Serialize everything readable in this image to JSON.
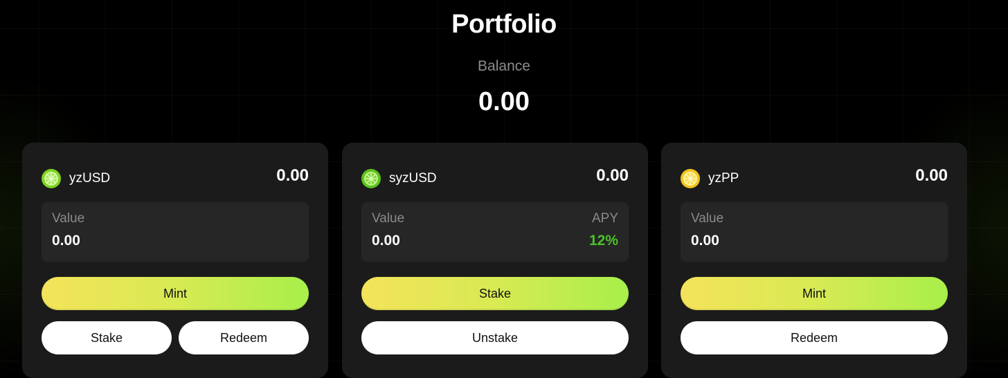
{
  "header": {
    "title": "Portfolio",
    "balance_label": "Balance",
    "balance_value": "0.00"
  },
  "colors": {
    "background": "#000000",
    "card": "#1b1b1b",
    "value_box": "#262626",
    "accent_gradient_start": "#f4e35a",
    "accent_gradient_end": "#a8ef4a",
    "apy_green": "#4cc22a"
  },
  "cards": [
    {
      "name": "yzUSD",
      "icon": "lime-slice-icon",
      "amount": "0.00",
      "value_label": "Value",
      "value": "0.00",
      "primary_button": "Mint",
      "secondary_buttons": [
        "Stake",
        "Redeem"
      ]
    },
    {
      "name": "syzUSD",
      "icon": "lime-slice-icon",
      "amount": "0.00",
      "value_label": "Value",
      "value": "0.00",
      "apy_label": "APY",
      "apy_value": "12%",
      "primary_button": "Stake",
      "secondary_buttons": [
        "Unstake"
      ]
    },
    {
      "name": "yzPP",
      "icon": "lemon-slice-icon",
      "amount": "0.00",
      "value_label": "Value",
      "value": "0.00",
      "primary_button": "Mint",
      "secondary_buttons": [
        "Redeem"
      ]
    }
  ]
}
